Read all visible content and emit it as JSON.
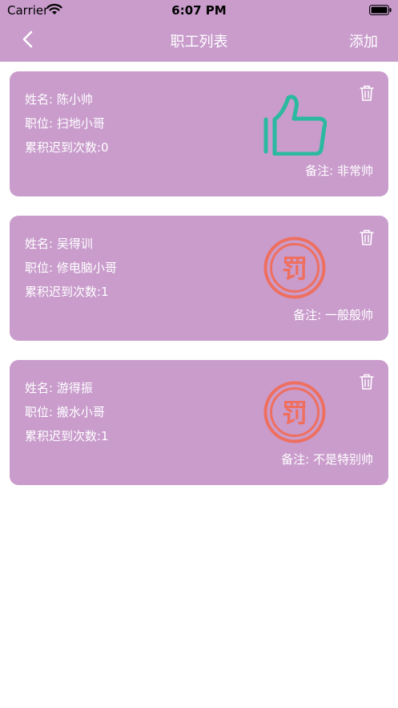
{
  "status_bar": {
    "carrier": "Carrier",
    "time": "6:07 PM"
  },
  "navbar": {
    "title": "职工列表",
    "add_label": "添加"
  },
  "employees": [
    {
      "name_line": "姓名: 陈小帅",
      "position_line": "职位: 扫地小哥",
      "late_line": "累积迟到次数:0",
      "remark_line": "备注: 非常帅",
      "badge": "thumbs-up-icon"
    },
    {
      "name_line": "姓名: 吴得训",
      "position_line": "职位: 修电脑小哥",
      "late_line": "累积迟到次数:1",
      "remark_line": "备注: 一般般帅",
      "badge": "penalty-stamp-icon",
      "badge_text": "罚"
    },
    {
      "name_line": "姓名: 游得振",
      "position_line": "职位: 搬水小哥",
      "late_line": "累积迟到次数:1",
      "remark_line": "备注: 不是特别帅",
      "badge": "penalty-stamp-icon",
      "badge_text": "罚"
    }
  ],
  "colors": {
    "header_bg": "#c99ccc",
    "card_bg": "#c99ccc",
    "thumb": "#2bb99f",
    "stamp": "#ef6f5f"
  }
}
